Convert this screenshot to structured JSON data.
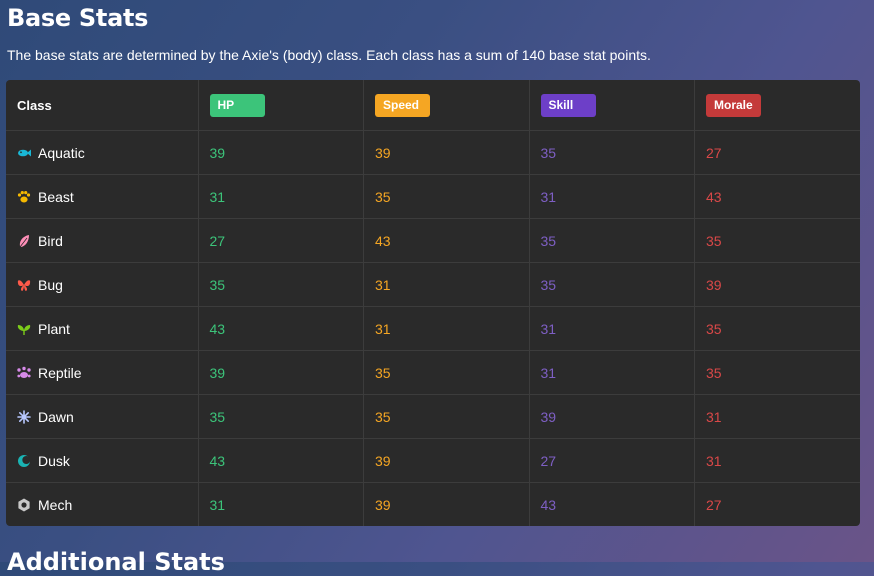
{
  "page": {
    "title": "Base Stats",
    "description": "The base stats are determined by the Axie's (body) class. Each class has a sum of 140 base stat points.",
    "next_heading": "Additional Stats"
  },
  "table": {
    "headers": {
      "class": "Class",
      "hp": "HP",
      "speed": "Speed",
      "skill": "Skill",
      "morale": "Morale"
    },
    "colors": {
      "hp": "#3cc47a",
      "speed": "#f5a623",
      "skill": "#6d3fc8",
      "morale": "#c43a3a"
    },
    "rows": [
      {
        "name": "Aquatic",
        "icon": "fish-icon",
        "icon_color": "#1ab8d6",
        "hp": "39",
        "speed": "39",
        "skill": "35",
        "morale": "27"
      },
      {
        "name": "Beast",
        "icon": "paw-icon",
        "icon_color": "#f5b800",
        "hp": "31",
        "speed": "35",
        "skill": "31",
        "morale": "43"
      },
      {
        "name": "Bird",
        "icon": "feather-icon",
        "icon_color": "#ff8fb8",
        "hp": "27",
        "speed": "43",
        "skill": "35",
        "morale": "35"
      },
      {
        "name": "Bug",
        "icon": "butterfly-icon",
        "icon_color": "#ff5a4a",
        "hp": "35",
        "speed": "31",
        "skill": "35",
        "morale": "39"
      },
      {
        "name": "Plant",
        "icon": "leaf-icon",
        "icon_color": "#7ccc1a",
        "hp": "43",
        "speed": "31",
        "skill": "31",
        "morale": "35"
      },
      {
        "name": "Reptile",
        "icon": "reptile-icon",
        "icon_color": "#d68ae8",
        "hp": "39",
        "speed": "35",
        "skill": "31",
        "morale": "35"
      },
      {
        "name": "Dawn",
        "icon": "sparkle-icon",
        "icon_color": "#b8c8ff",
        "hp": "35",
        "speed": "35",
        "skill": "39",
        "morale": "31"
      },
      {
        "name": "Dusk",
        "icon": "moon-icon",
        "icon_color": "#1ab3b3",
        "hp": "43",
        "speed": "39",
        "skill": "27",
        "morale": "31"
      },
      {
        "name": "Mech",
        "icon": "gear-icon",
        "icon_color": "#c8c8c8",
        "hp": "31",
        "speed": "39",
        "skill": "43",
        "morale": "27"
      }
    ]
  }
}
